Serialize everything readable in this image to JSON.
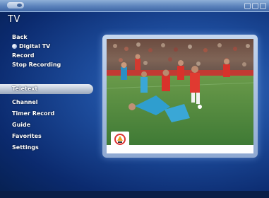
{
  "window": {
    "section_title": "TV"
  },
  "menu": {
    "items": [
      {
        "label": "Back"
      },
      {
        "label": "Digital TV",
        "icon": "circle-icon"
      },
      {
        "label": "Record"
      },
      {
        "label": "Stop Recording"
      },
      {
        "label": "Teletext",
        "selected": true
      },
      {
        "label": "Channel"
      },
      {
        "label": "Timer Record"
      },
      {
        "label": "Guide"
      },
      {
        "label": "Favorites"
      },
      {
        "label": "Settings"
      }
    ]
  },
  "preview": {
    "content": "live-tv-preview",
    "channel_logo_icon": "channel-logo-icon"
  },
  "statusbar": {
    "text": ""
  },
  "colors": {
    "background": "#1d4c9c",
    "selected_item": "#c9d2de",
    "preview_frame": "#c6d7ee"
  }
}
